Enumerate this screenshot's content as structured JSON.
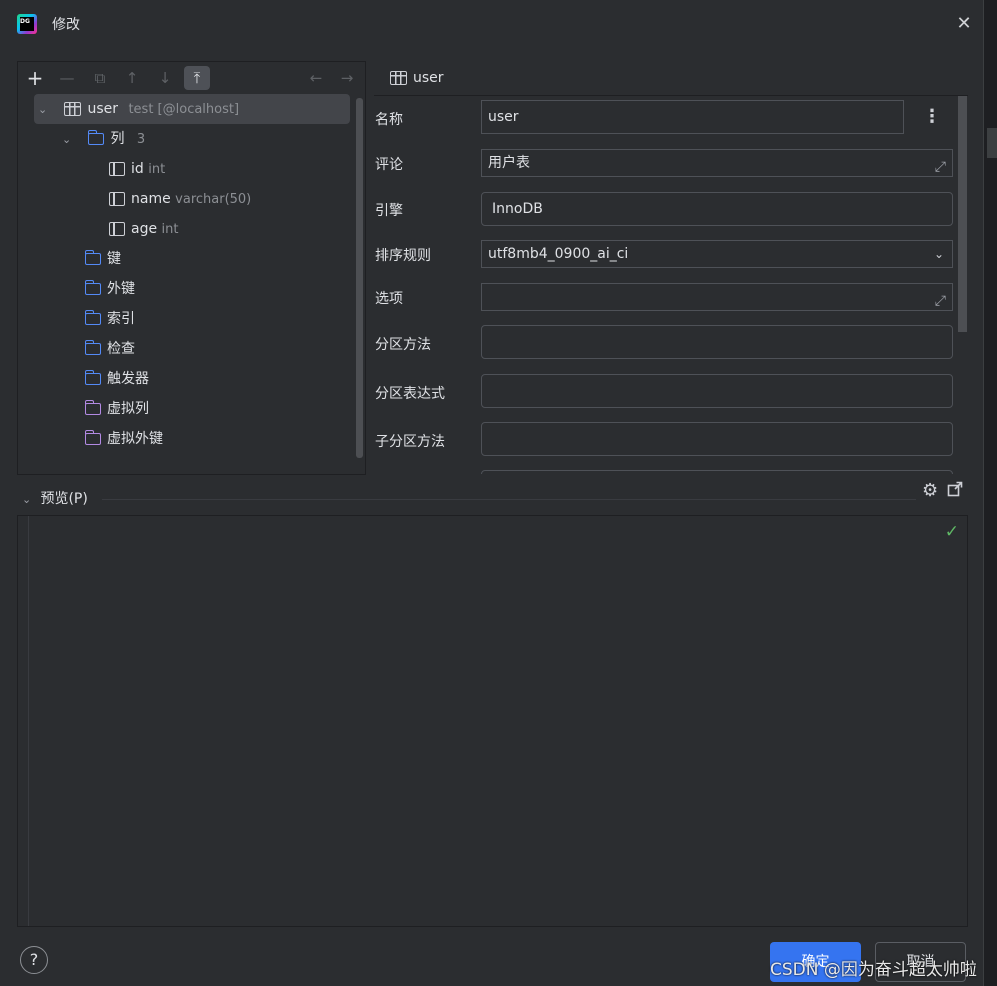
{
  "window": {
    "title": "修改"
  },
  "toolbar": {
    "add": "+",
    "remove": "—",
    "copy": "⧉",
    "move_up": "↑",
    "move_down": "↓",
    "move_top": "⤒",
    "back": "←",
    "forward": "→"
  },
  "tree": {
    "table": {
      "label": "user",
      "hint": "test [@localhost]"
    },
    "columns_folder": {
      "label": "列",
      "count": "3"
    },
    "columns": [
      {
        "name": "id",
        "type": "int"
      },
      {
        "name": "name",
        "type": "varchar(50)"
      },
      {
        "name": "age",
        "type": "int"
      }
    ],
    "folders": [
      "键",
      "外键",
      "索引",
      "检查",
      "触发器"
    ],
    "virtual_folders": [
      "虚拟列",
      "虚拟外键"
    ]
  },
  "form": {
    "tab_label": "user",
    "name": {
      "label": "名称",
      "value": "user"
    },
    "comment": {
      "label": "评论",
      "value": "用户表"
    },
    "engine": {
      "label": "引擎",
      "value": "InnoDB"
    },
    "collation": {
      "label": "排序规则",
      "value": "utf8mb4_0900_ai_ci"
    },
    "options": {
      "label": "选项",
      "value": ""
    },
    "partition_method": {
      "label": "分区方法",
      "value": ""
    },
    "partition_expression": {
      "label": "分区表达式",
      "value": ""
    },
    "subpartition_method": {
      "label": "子分区方法",
      "value": ""
    }
  },
  "preview": {
    "label": "预览(P)"
  },
  "buttons": {
    "ok": "确定",
    "cancel": "取消",
    "help": "?"
  },
  "watermark": "CSDN @因为奋斗超太帅啦",
  "icons": {
    "status": "check-icon",
    "settings": "gear-icon",
    "popout": "popout-icon"
  },
  "colors": {
    "accent": "#3574f0",
    "folder": "#548af7",
    "virtual_folder": "#b38ae3",
    "ok": "#5fb865"
  }
}
